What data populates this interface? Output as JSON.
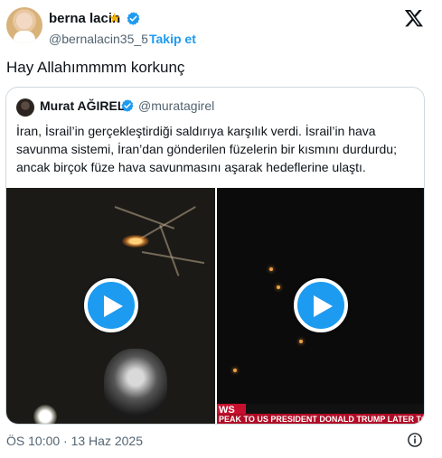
{
  "author": {
    "name": "berna lacin",
    "handle": "@bernalacin35_5",
    "separator": "·",
    "follow_label": "Takip et"
  },
  "tweet": {
    "text": "Hay Allahımmmm korkunç",
    "timestamp": "ÖS 10:00 · 13 Haz 2025"
  },
  "quoted": {
    "name": "Murat AĞIREL",
    "handle": "@muratagirel",
    "text": "İran, İsrail’in gerçekleştirdiği saldırıya karşılık verdi. İsrail’in hava savunma sistemi, İran’dan gönderilen füzelerin bir kısmını durdurdu; ancak birçok füze hava savunmasını aşarak hedeflerine ulaştı.",
    "ticker_tag": "WS",
    "ticker_text": "PEAK TO US PRESIDENT DONALD TRUMP LATER TODAY"
  },
  "icons": {
    "star": "star-icon",
    "verified": "verified-icon",
    "x_logo": "x-logo-icon",
    "play": "play-icon",
    "info": "info-icon"
  },
  "colors": {
    "accent": "#1d9bf0",
    "text": "#0f1419",
    "muted": "#536471",
    "ticker_red": "#c8102e",
    "star": "#f5b000"
  }
}
